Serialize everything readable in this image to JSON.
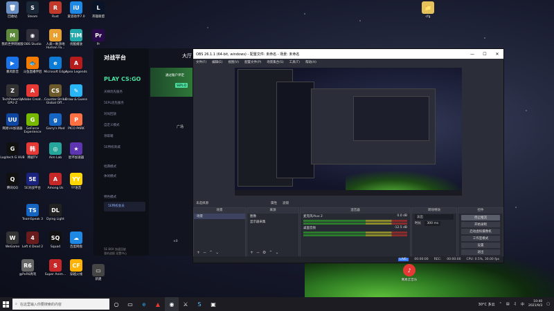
{
  "desktop_icons": [
    {
      "label": "回收站",
      "glyph": "🗑",
      "color": "#6a8fc4"
    },
    {
      "label": "Steam",
      "glyph": "S",
      "color": "#1b2838"
    },
    {
      "label": "Rust",
      "glyph": "R",
      "color": "#c0392b"
    },
    {
      "label": "爱思助手7.0",
      "glyph": "iU",
      "color": "#1e88e5"
    },
    {
      "label": "英雄联盟",
      "glyph": "L",
      "color": "#0a1428"
    },
    {
      "label": "我的世界网易版",
      "glyph": "M",
      "color": "#5d8a3a"
    },
    {
      "label": "OBS Studio",
      "glyph": "◉",
      "color": "#302e3a"
    },
    {
      "label": "人类一败涂地 Human Fa...",
      "glyph": "H",
      "color": "#e8a030"
    },
    {
      "label": "优酷播放",
      "glyph": "TIM",
      "color": "#2aa"
    },
    {
      "label": "Pr",
      "glyph": "Pr",
      "color": "#2a0a4a"
    },
    {
      "label": "暴风影音",
      "glyph": "▶",
      "color": "#1a73e8"
    },
    {
      "label": "斗鱼直播伴侣",
      "glyph": "🐟",
      "color": "#f57c00"
    },
    {
      "label": "Microsoft Edge",
      "glyph": "e",
      "color": "#0c7bd6"
    },
    {
      "label": "Apex Legends",
      "glyph": "A",
      "color": "#b71c1c"
    },
    {
      "label": "TechPowerUp GPU-Z",
      "glyph": "Z",
      "color": "#333"
    },
    {
      "label": "Adobe Creat...",
      "glyph": "A",
      "color": "#e53935"
    },
    {
      "label": "Counter-Strike Global Off...",
      "glyph": "CS",
      "color": "#6d5a2a"
    },
    {
      "label": "Draw & Guess",
      "glyph": "✎",
      "color": "#29b6f6"
    },
    {
      "label": "网易UU加速器",
      "glyph": "UU",
      "color": "#0d47a1"
    },
    {
      "label": "GeForce Experience",
      "glyph": "G",
      "color": "#76b900"
    },
    {
      "label": "Garry's Mod",
      "glyph": "g",
      "color": "#1565c0"
    },
    {
      "label": "PICO PARK",
      "glyph": "P",
      "color": "#ff7043"
    },
    {
      "label": "Logitech G HUB",
      "glyph": "G",
      "color": "#111"
    },
    {
      "label": "韩剧TV",
      "glyph": "韩",
      "color": "#e53935"
    },
    {
      "label": "Aim Lab",
      "glyph": "◎",
      "color": "#26a69a"
    },
    {
      "label": "星环加速器",
      "glyph": "★",
      "color": "#5e35b1"
    },
    {
      "label": "腾讯QQ",
      "glyph": "Q",
      "color": "#111"
    },
    {
      "label": "5E对战平台",
      "glyph": "5E",
      "color": "#1a237e"
    },
    {
      "label": "Among Us",
      "glyph": "A",
      "color": "#c62828"
    },
    {
      "label": "YY语音",
      "glyph": "YY",
      "color": "#ffd600"
    },
    {
      "label": "TeamSpeak 3",
      "glyph": "TS",
      "color": "#1565c0"
    },
    {
      "label": "Dying Light",
      "glyph": "DL",
      "color": "#222"
    },
    {
      "label": "WeGame",
      "glyph": "W",
      "color": "#333"
    },
    {
      "label": "Left 4 Dead 2",
      "glyph": "4",
      "color": "#6a1b1b"
    },
    {
      "label": "Squad",
      "glyph": "SQ",
      "color": "#111"
    },
    {
      "label": "百度网盘",
      "glyph": "☁",
      "color": "#1e88e5"
    },
    {
      "label": "@PxR6周刊",
      "glyph": "R6",
      "color": "#666"
    },
    {
      "label": "Super Anim...",
      "glyph": "S",
      "color": "#c62828"
    },
    {
      "label": "穿越火线",
      "glyph": "CF",
      "color": "#ffb300"
    },
    {
      "label": "新建",
      "glyph": "▭",
      "color": "#444"
    },
    {
      "label": "cfg",
      "glyph": "📁",
      "color": "#e6c35a"
    }
  ],
  "launcher": {
    "brand": "对战平台",
    "game": "PLAY CS:GO",
    "lobby": "大厅",
    "menu": [
      "天梯优先服务",
      "5EPL优先服务",
      "对局回放",
      "自定义模式",
      "领取箱",
      "5E特权商城",
      "经典模式",
      "休闲模式",
      "特色模式"
    ],
    "vip": "5E特权会员",
    "banner_text": "通过账户评定",
    "banner_badge": "SEPL-D",
    "plaza": "广场",
    "bottom": [
      "5E BOX",
      "快速回放",
      "我的战报",
      "设置中心"
    ],
    "count": "×0"
  },
  "obs": {
    "title": "OBS 26.1.1 (64-bit, windows) - 配置文件: 未命名 - 场景: 未命名",
    "menu": [
      "文件(F)",
      "编辑(E)",
      "视图(V)",
      "配置文件(P)",
      "场景集合(S)",
      "工具(T)",
      "帮助(H)"
    ],
    "preview_toolbar": [
      "未选择源",
      "属性",
      "滤镜"
    ],
    "scenes_header": "场景",
    "scenes": [
      "场景"
    ],
    "sources_header": "来源",
    "sources": [
      "图像",
      "显示器采集"
    ],
    "mixer_header": "混音器",
    "mixer": [
      {
        "name": "麦克风/Aux 2",
        "db": "0.0 dB"
      },
      {
        "name": "桌面音频",
        "db": "-12.5 dB"
      }
    ],
    "transitions_header": "转场特效",
    "transition_type": "淡出",
    "duration_label": "时长",
    "duration_value": "300 ms",
    "controls_header": "控件",
    "controls": [
      "停止推流",
      "开始录制",
      "启动虚拟摄像机",
      "工作室模式",
      "设置",
      "退出"
    ],
    "status": {
      "live_label": "LIVE:",
      "live_time": "00:00:00",
      "rec_label": "REC:",
      "rec_time": "00:00:00",
      "cpu": "CPU: 0.5%, 30.00 fps"
    }
  },
  "netease": {
    "label": "网易云音乐"
  },
  "taskbar": {
    "search_placeholder": "在这里输入你要搜索的内容",
    "weather": "30°C 多云",
    "time": "10:40",
    "date": "2021/9/3",
    "lang": "中"
  }
}
